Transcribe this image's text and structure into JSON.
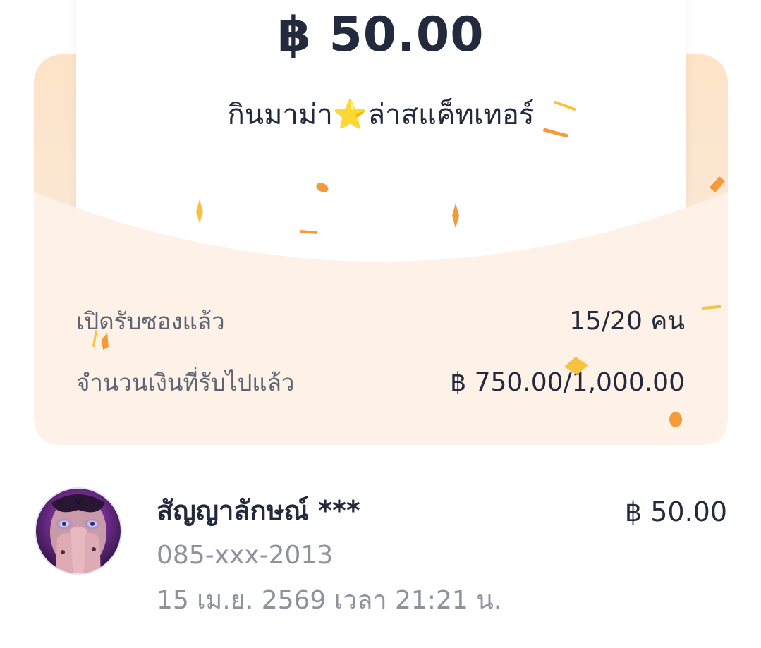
{
  "envelope": {
    "amount": "฿ 50.00",
    "title": "กินมาม่า⭐ล่าสแค็ทเทอร์"
  },
  "stats": {
    "opened_label": "เปิดรับซองแล้ว",
    "opened_value": "15/20 คน",
    "received_label": "จำนวนเงินที่รับไปแล้ว",
    "received_value": "฿ 750.00/1,000.00"
  },
  "recipients": [
    {
      "name": "สัญญาลักษณ์ ***",
      "phone": "085-xxx-2013",
      "datetime": "15 เม.ย. 2569 เวลา 21:21 น.",
      "amount": "฿ 50.00"
    }
  ],
  "colors": {
    "envelope_peach": "#fde3c7",
    "envelope_front": "#fef1e7",
    "confetti_orange": "#f39a3a",
    "confetti_yellow": "#f7c242",
    "text_dark": "#232a3d",
    "text_gray": "#8d929c"
  },
  "icons": {
    "star": "star-emoji",
    "avatar": "user-avatar-image"
  }
}
